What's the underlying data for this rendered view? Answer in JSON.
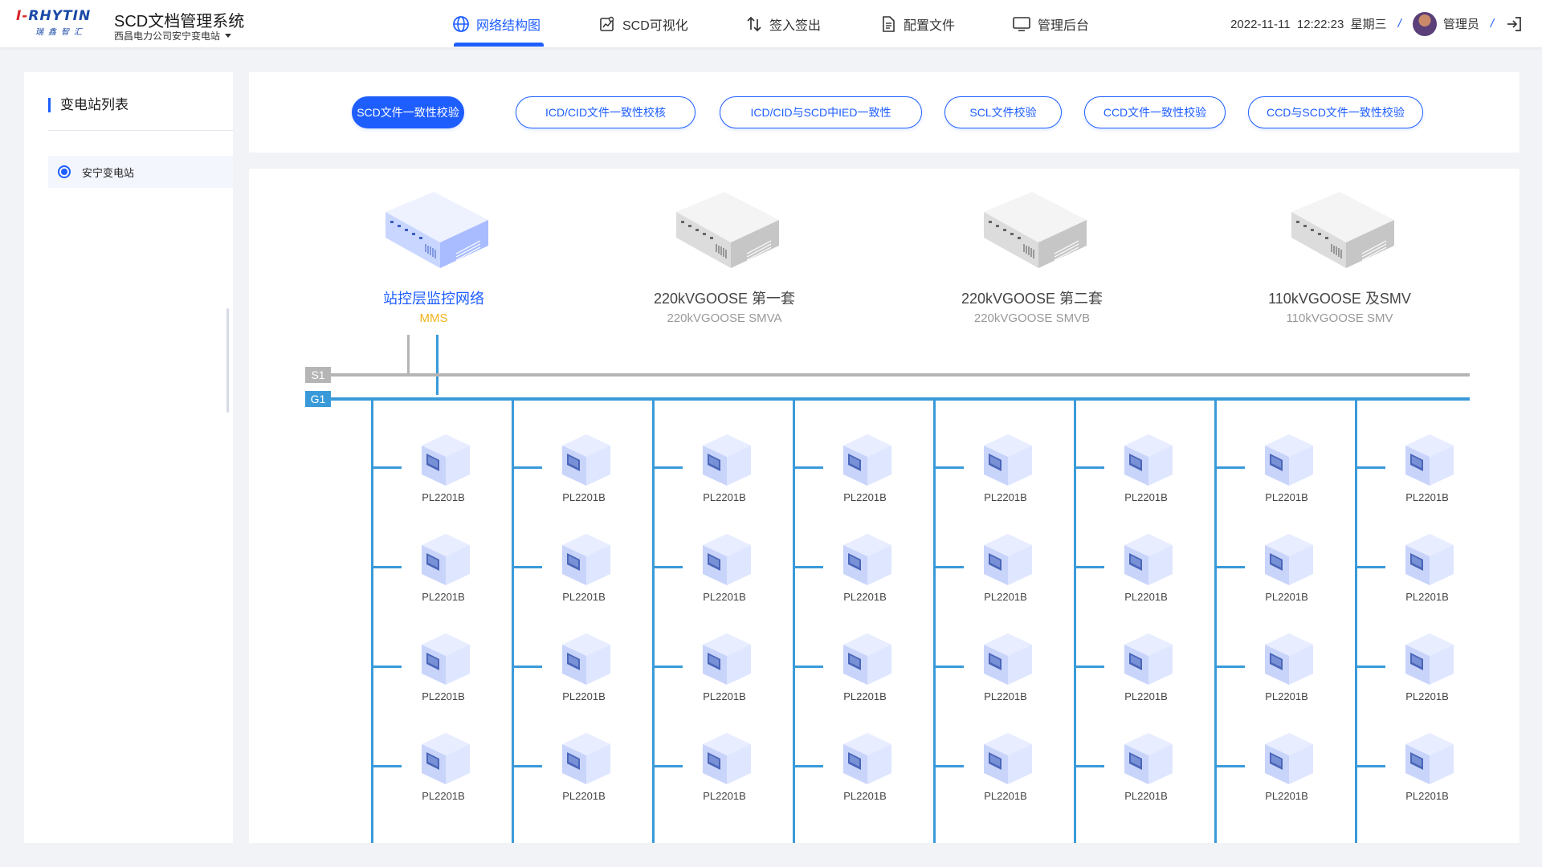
{
  "header": {
    "logo_main_red": "I-",
    "logo_main_blue": "RHYTIN",
    "logo_sub": "瑞鑫智汇",
    "title": "SCD文档管理系统",
    "subtitle": "西昌电力公司安宁变电站",
    "nav": [
      {
        "label": "网络结构图",
        "icon": "globe-icon"
      },
      {
        "label": "SCD可视化",
        "icon": "chart-image-icon"
      },
      {
        "label": "签入签出",
        "icon": "swap-icon"
      },
      {
        "label": "配置文件",
        "icon": "document-icon"
      },
      {
        "label": "管理后台",
        "icon": "monitor-icon"
      }
    ],
    "datetime": "2022-11-11  12:22:23  星期三",
    "user": "管理员",
    "logout_icon": "logout-icon"
  },
  "sidebar": {
    "title": "变电站列表",
    "stations": [
      {
        "label": "安宁变电站",
        "selected": true
      }
    ]
  },
  "toolbar": {
    "buttons": [
      {
        "label": "SCD文件一致性校验",
        "active": true
      },
      {
        "label": "ICD/CID文件一致性校核",
        "active": false
      },
      {
        "label": "ICD/CID与SCD中IED一致性",
        "active": false
      },
      {
        "label": "SCL文件校验",
        "active": false
      },
      {
        "label": "CCD文件一致性校验",
        "active": false
      },
      {
        "label": "CCD与SCD文件一致性校验",
        "active": false
      }
    ]
  },
  "diagram": {
    "networks": [
      {
        "title": "站控层监控网络",
        "subtitle": "MMS",
        "color": "blue"
      },
      {
        "title": "220kVGOOSE 第一套",
        "subtitle": "220kVGOOSE SMVA",
        "color": "gray"
      },
      {
        "title": "220kVGOOSE 第二套",
        "subtitle": "220kVGOOSE SMVB",
        "color": "gray"
      },
      {
        "title": "110kVGOOSE 及SMV",
        "subtitle": "110kVGOOSE SMV",
        "color": "gray"
      }
    ],
    "buses": [
      {
        "label": "S1",
        "color": "#b5b5b5"
      },
      {
        "label": "G1",
        "color": "#3a9ad9"
      }
    ],
    "device_model": "PL2201B",
    "device_columns": 8,
    "device_rows": 4,
    "colors": {
      "accent": "#1e5eff",
      "bus_s1": "#b5b5b5",
      "bus_g1": "#3a9ad9",
      "mms": "#f0b31a"
    }
  }
}
